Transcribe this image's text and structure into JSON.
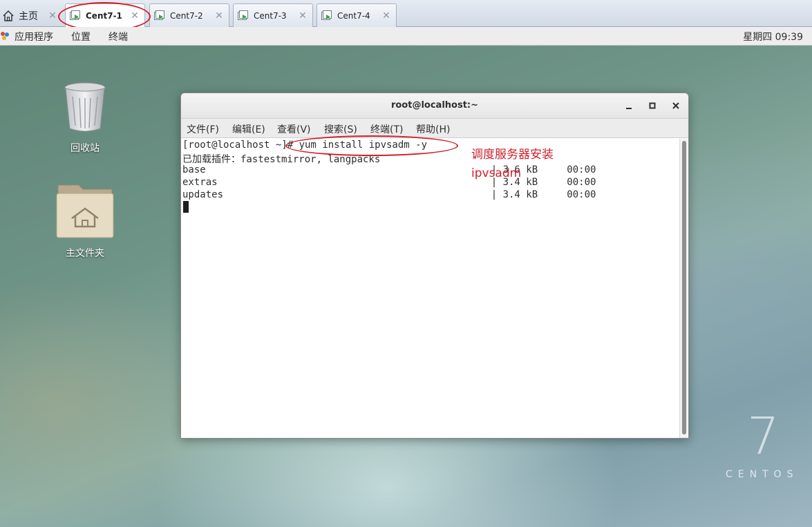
{
  "vm_tabs": {
    "home_label": "主页",
    "tabs": [
      {
        "label": "Cent7-1",
        "active": true
      },
      {
        "label": "Cent7-2",
        "active": false
      },
      {
        "label": "Cent7-3",
        "active": false
      },
      {
        "label": "Cent7-4",
        "active": false
      }
    ]
  },
  "topbar": {
    "applications": "应用程序",
    "places": "位置",
    "terminal": "终端",
    "clock": "星期四 09:39"
  },
  "desktop": {
    "trash_label": "回收站",
    "home_folder_label": "主文件夹",
    "brand_number": "7",
    "brand_word": "CENTOS"
  },
  "terminal": {
    "title": "root@localhost:~",
    "menu": {
      "file": "文件(F)",
      "edit": "编辑(E)",
      "view": "查看(V)",
      "search": "搜索(S)",
      "terminal": "终端(T)",
      "help": "帮助(H)"
    },
    "lines": [
      "[root@localhost ~]# yum install ipvsadm -y",
      "已加载插件：fastestmirror, langpacks",
      "base                                                 | 3.6 kB     00:00",
      "extras                                               | 3.4 kB     00:00",
      "updates                                              | 3.4 kB     00:00"
    ]
  },
  "annotation": {
    "line1": "调度服务器安装",
    "line2": "ipvsadm",
    "color": "#d0202a"
  }
}
